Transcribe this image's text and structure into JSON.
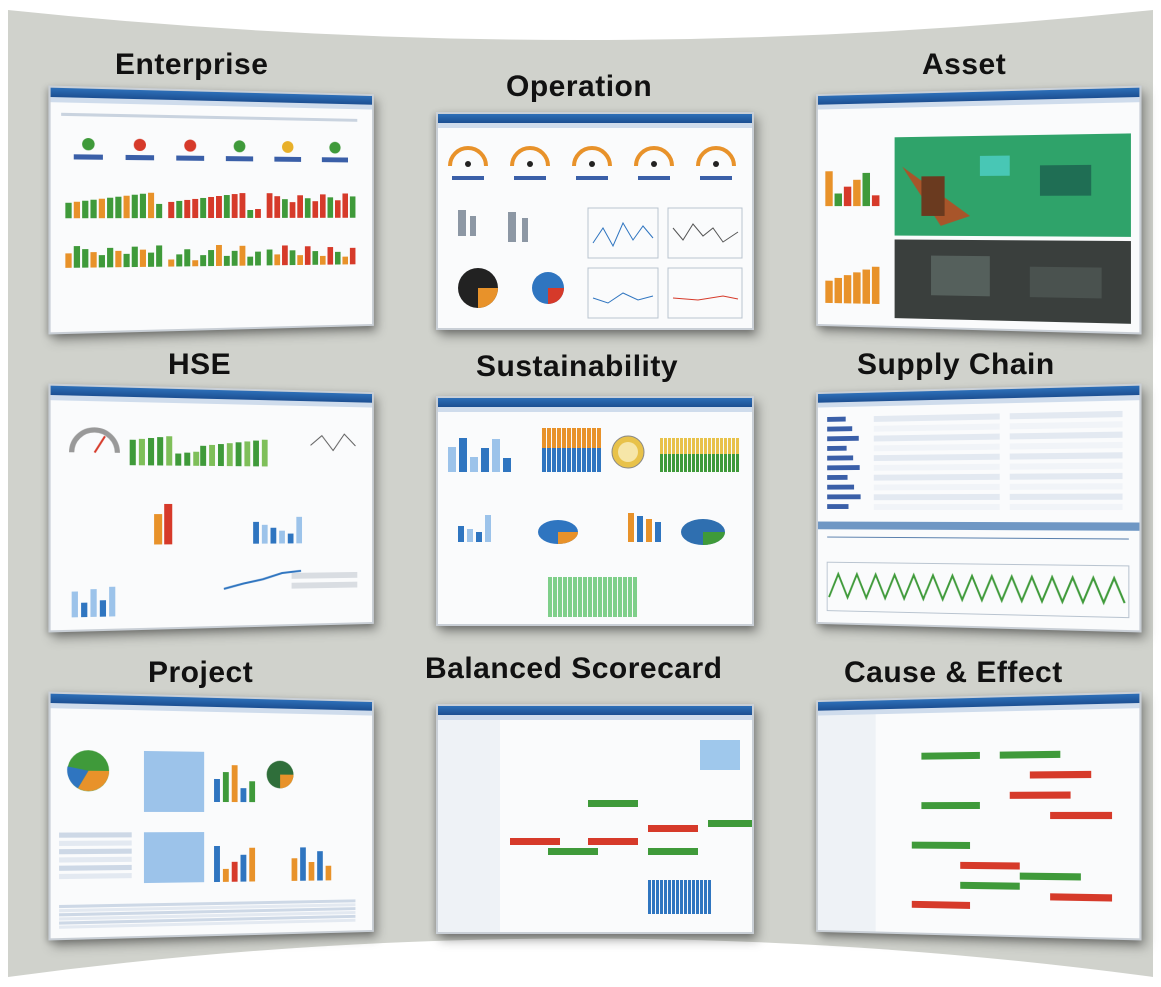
{
  "tiles": [
    {
      "title": "Enterprise"
    },
    {
      "title": "Operation"
    },
    {
      "title": "Asset"
    },
    {
      "title": "HSE"
    },
    {
      "title": "Sustainability"
    },
    {
      "title": "Supply Chain"
    },
    {
      "title": "Project"
    },
    {
      "title": "Balanced Scorecard"
    },
    {
      "title": "Cause & Effect"
    }
  ],
  "colors": {
    "panel": "#d0d2cc",
    "titlebar": "#2d6fb8",
    "green": "#3f9a3a",
    "red": "#d63a2a",
    "orange": "#e8922a",
    "blue": "#2f75c0"
  }
}
